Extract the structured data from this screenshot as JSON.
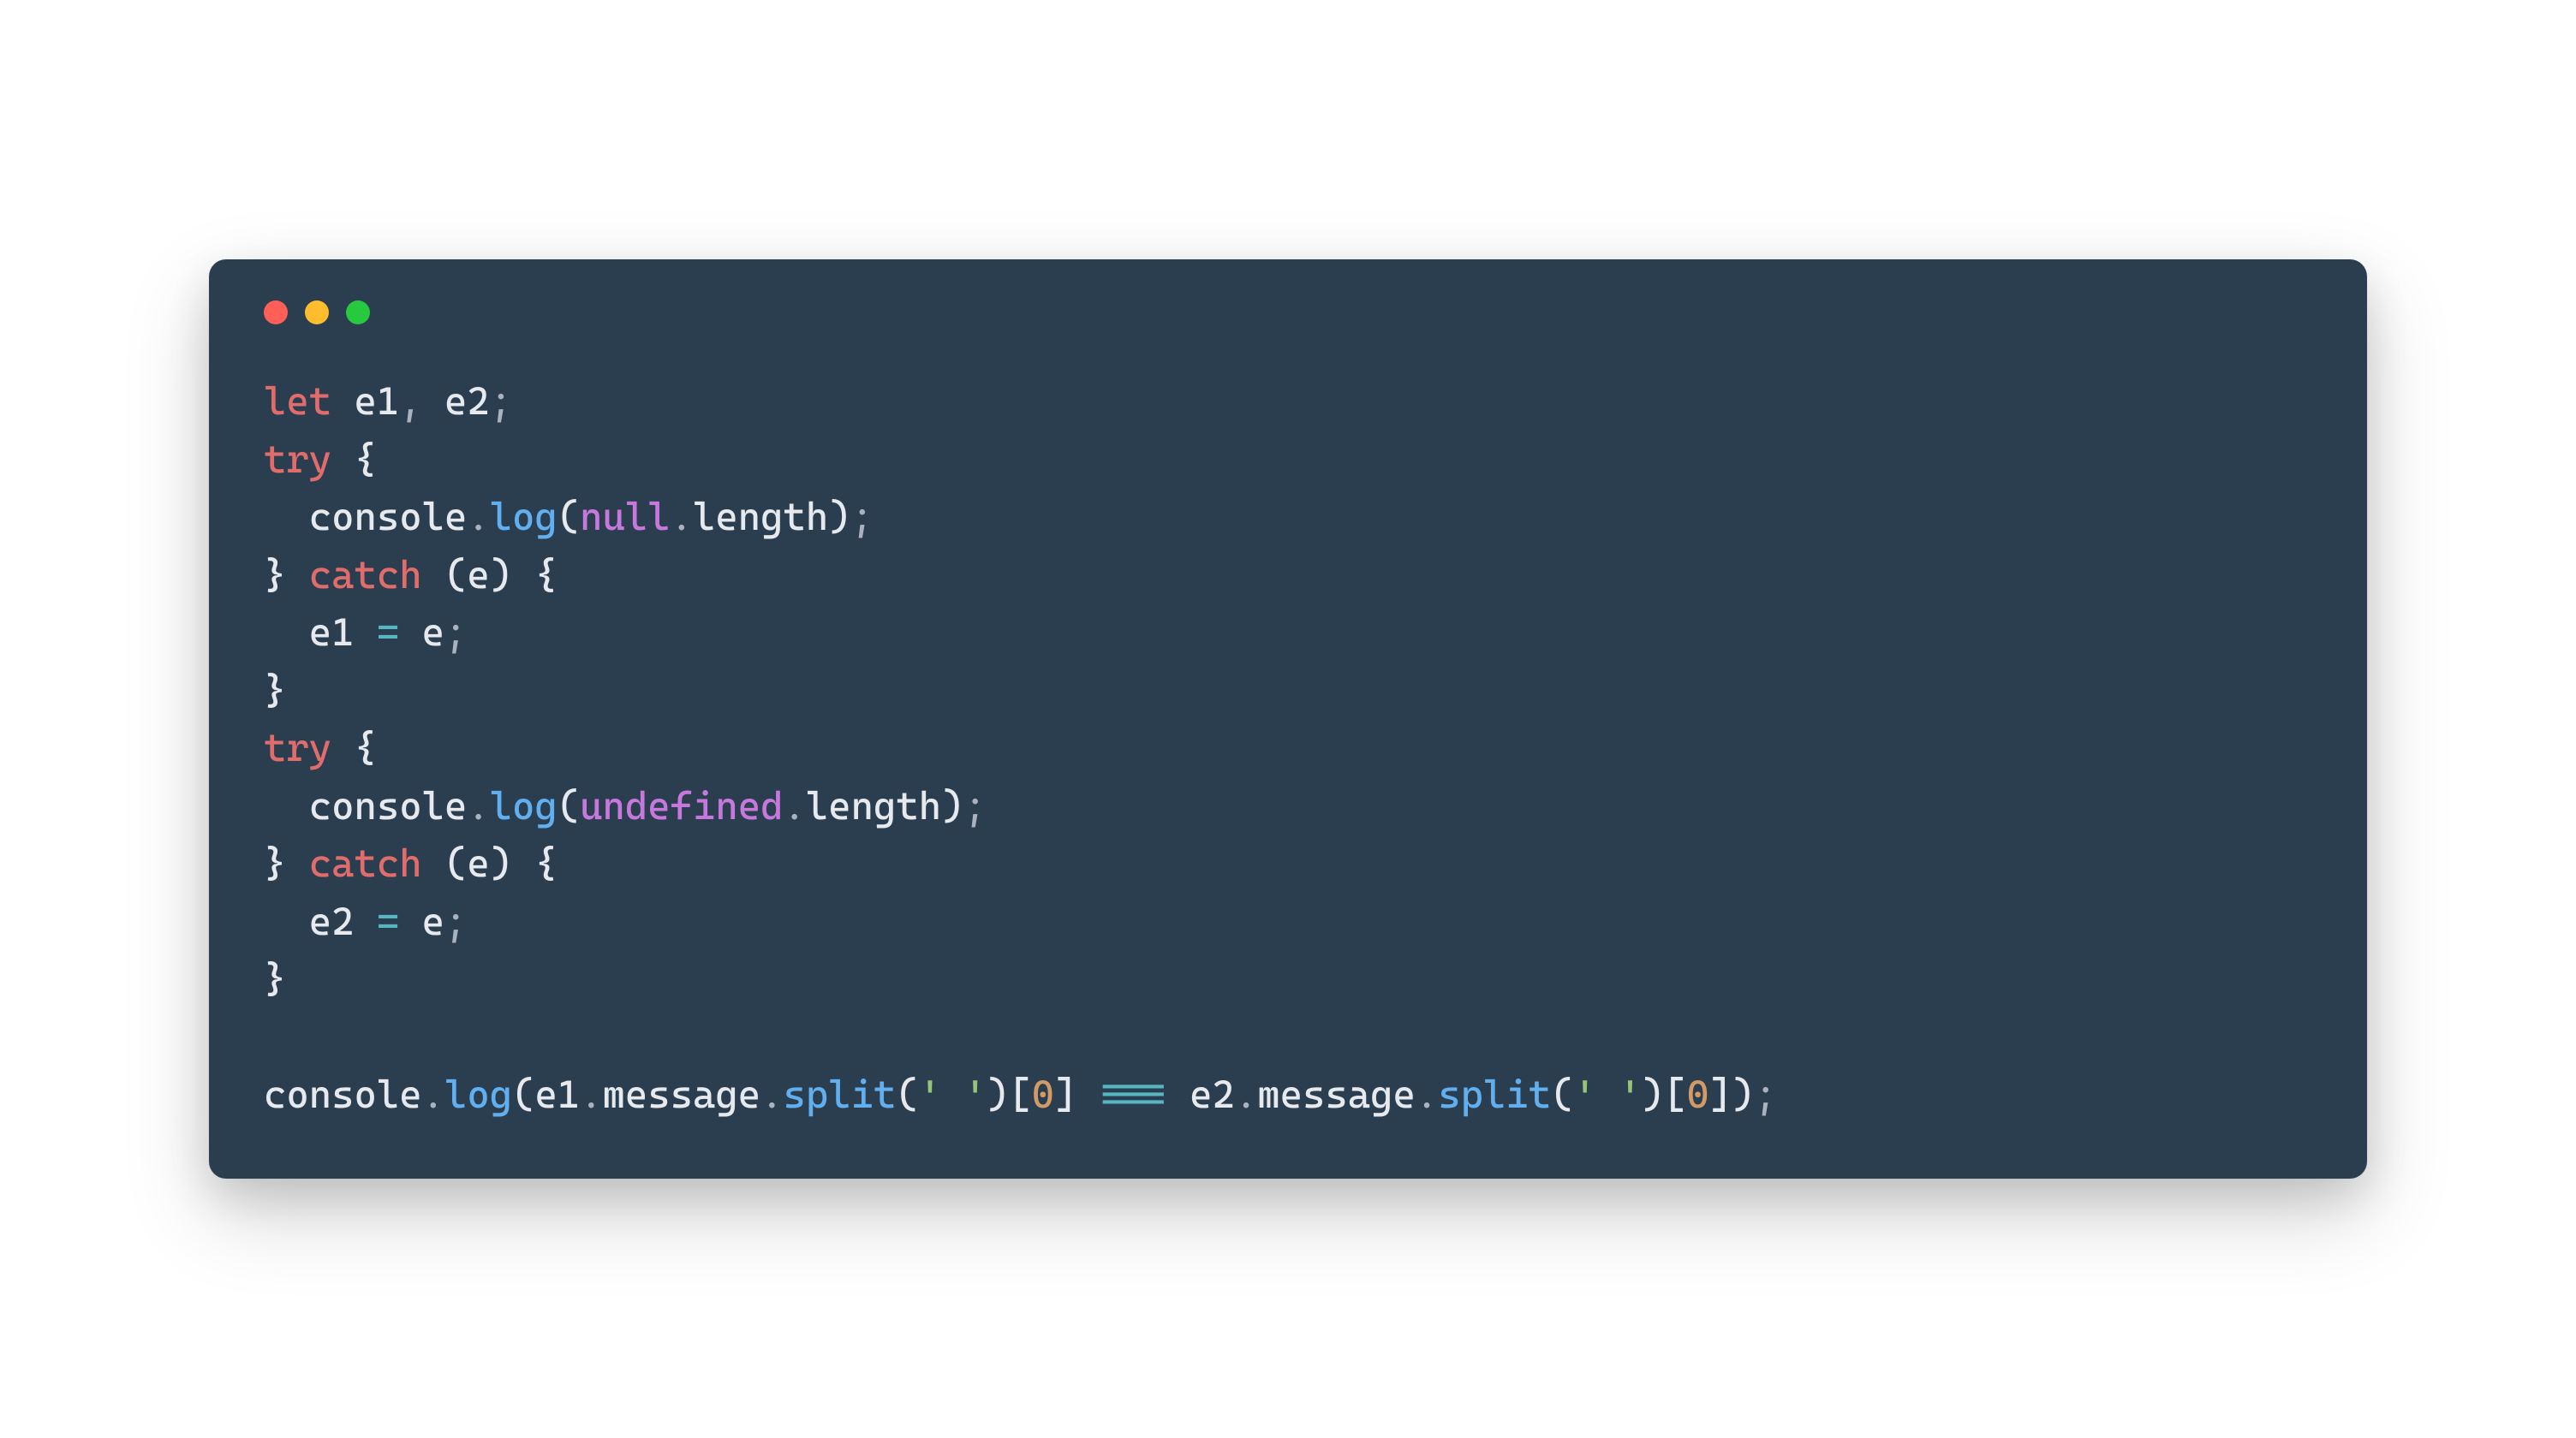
{
  "window": {
    "traffic_lights": [
      "red",
      "yellow",
      "green"
    ]
  },
  "code": {
    "language": "javascript",
    "lines": [
      [
        {
          "cls": "tok-kw",
          "t": "let"
        },
        {
          "cls": "tok-var",
          "t": " e1"
        },
        {
          "cls": "tok-punc",
          "t": ","
        },
        {
          "cls": "tok-var",
          "t": " e2"
        },
        {
          "cls": "tok-punc",
          "t": ";"
        }
      ],
      [
        {
          "cls": "tok-kw",
          "t": "try"
        },
        {
          "cls": "tok-var",
          "t": " "
        },
        {
          "cls": "tok-brace",
          "t": "{"
        }
      ],
      [
        {
          "cls": "tok-var",
          "t": "  console"
        },
        {
          "cls": "tok-punc",
          "t": "."
        },
        {
          "cls": "tok-fn",
          "t": "log"
        },
        {
          "cls": "tok-paren",
          "t": "("
        },
        {
          "cls": "tok-null",
          "t": "null"
        },
        {
          "cls": "tok-punc",
          "t": "."
        },
        {
          "cls": "tok-prop",
          "t": "length"
        },
        {
          "cls": "tok-paren",
          "t": ")"
        },
        {
          "cls": "tok-punc",
          "t": ";"
        }
      ],
      [
        {
          "cls": "tok-brace",
          "t": "}"
        },
        {
          "cls": "tok-var",
          "t": " "
        },
        {
          "cls": "tok-kw",
          "t": "catch"
        },
        {
          "cls": "tok-var",
          "t": " "
        },
        {
          "cls": "tok-paren",
          "t": "("
        },
        {
          "cls": "tok-var",
          "t": "e"
        },
        {
          "cls": "tok-paren",
          "t": ")"
        },
        {
          "cls": "tok-var",
          "t": " "
        },
        {
          "cls": "tok-brace",
          "t": "{"
        }
      ],
      [
        {
          "cls": "tok-var",
          "t": "  e1 "
        },
        {
          "cls": "tok-op",
          "t": "="
        },
        {
          "cls": "tok-var",
          "t": " e"
        },
        {
          "cls": "tok-punc",
          "t": ";"
        }
      ],
      [
        {
          "cls": "tok-brace",
          "t": "}"
        }
      ],
      [
        {
          "cls": "tok-kw",
          "t": "try"
        },
        {
          "cls": "tok-var",
          "t": " "
        },
        {
          "cls": "tok-brace",
          "t": "{"
        }
      ],
      [
        {
          "cls": "tok-var",
          "t": "  console"
        },
        {
          "cls": "tok-punc",
          "t": "."
        },
        {
          "cls": "tok-fn",
          "t": "log"
        },
        {
          "cls": "tok-paren",
          "t": "("
        },
        {
          "cls": "tok-null",
          "t": "undefined"
        },
        {
          "cls": "tok-punc",
          "t": "."
        },
        {
          "cls": "tok-prop",
          "t": "length"
        },
        {
          "cls": "tok-paren",
          "t": ")"
        },
        {
          "cls": "tok-punc",
          "t": ";"
        }
      ],
      [
        {
          "cls": "tok-brace",
          "t": "}"
        },
        {
          "cls": "tok-var",
          "t": " "
        },
        {
          "cls": "tok-kw",
          "t": "catch"
        },
        {
          "cls": "tok-var",
          "t": " "
        },
        {
          "cls": "tok-paren",
          "t": "("
        },
        {
          "cls": "tok-var",
          "t": "e"
        },
        {
          "cls": "tok-paren",
          "t": ")"
        },
        {
          "cls": "tok-var",
          "t": " "
        },
        {
          "cls": "tok-brace",
          "t": "{"
        }
      ],
      [
        {
          "cls": "tok-var",
          "t": "  e2 "
        },
        {
          "cls": "tok-op",
          "t": "="
        },
        {
          "cls": "tok-var",
          "t": " e"
        },
        {
          "cls": "tok-punc",
          "t": ";"
        }
      ],
      [
        {
          "cls": "tok-brace",
          "t": "}"
        }
      ],
      [],
      [
        {
          "cls": "tok-var",
          "t": "console"
        },
        {
          "cls": "tok-punc",
          "t": "."
        },
        {
          "cls": "tok-fn",
          "t": "log"
        },
        {
          "cls": "tok-paren",
          "t": "("
        },
        {
          "cls": "tok-var",
          "t": "e1"
        },
        {
          "cls": "tok-punc",
          "t": "."
        },
        {
          "cls": "tok-prop",
          "t": "message"
        },
        {
          "cls": "tok-punc",
          "t": "."
        },
        {
          "cls": "tok-fn",
          "t": "split"
        },
        {
          "cls": "tok-paren",
          "t": "("
        },
        {
          "cls": "tok-str",
          "t": "' '"
        },
        {
          "cls": "tok-paren",
          "t": ")"
        },
        {
          "cls": "tok-brack",
          "t": "["
        },
        {
          "cls": "tok-num",
          "t": "0"
        },
        {
          "cls": "tok-brack",
          "t": "]"
        },
        {
          "cls": "tok-var",
          "t": " "
        },
        {
          "cls": "tok-op",
          "t": "==="
        },
        {
          "cls": "tok-var",
          "t": " e2"
        },
        {
          "cls": "tok-punc",
          "t": "."
        },
        {
          "cls": "tok-prop",
          "t": "message"
        },
        {
          "cls": "tok-punc",
          "t": "."
        },
        {
          "cls": "tok-fn",
          "t": "split"
        },
        {
          "cls": "tok-paren",
          "t": "("
        },
        {
          "cls": "tok-str",
          "t": "' '"
        },
        {
          "cls": "tok-paren",
          "t": ")"
        },
        {
          "cls": "tok-brack",
          "t": "["
        },
        {
          "cls": "tok-num",
          "t": "0"
        },
        {
          "cls": "tok-brack",
          "t": "]"
        },
        {
          "cls": "tok-paren",
          "t": ")"
        },
        {
          "cls": "tok-punc",
          "t": ";"
        }
      ]
    ]
  }
}
